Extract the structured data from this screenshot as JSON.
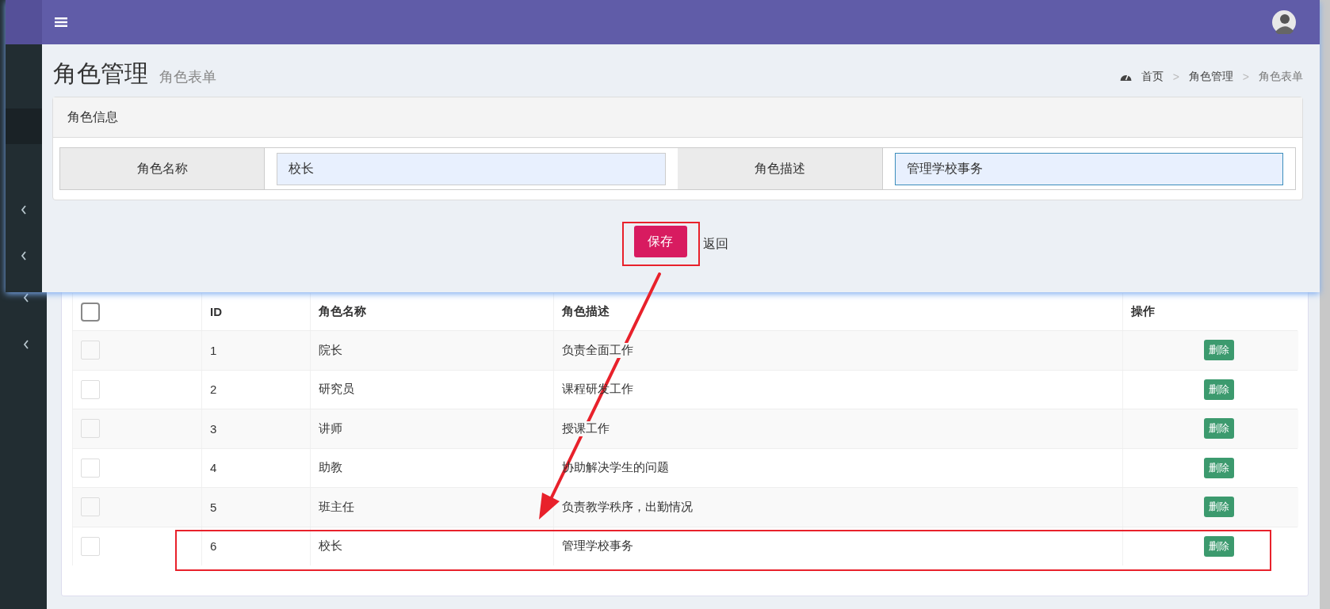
{
  "background_page": {
    "table": {
      "header_checkbox": {
        "checked": false
      },
      "columns": [
        "ID",
        "角色名称",
        "角色描述",
        "操作"
      ],
      "rows": [
        {
          "checked": false,
          "id": "1",
          "name": "院长",
          "description": "负责全面工作",
          "action": "删除"
        },
        {
          "checked": false,
          "id": "2",
          "name": "研究员",
          "description": "课程研发工作",
          "action": "删除"
        },
        {
          "checked": false,
          "id": "3",
          "name": "讲师",
          "description": "授课工作",
          "action": "删除"
        },
        {
          "checked": false,
          "id": "4",
          "name": "助教",
          "description": "协助解决学生的问题",
          "action": "删除"
        },
        {
          "checked": false,
          "id": "5",
          "name": "班主任",
          "description": "负责教学秩序，出勤情况",
          "action": "删除"
        },
        {
          "checked": false,
          "id": "6",
          "name": "校长",
          "description": "管理学校事务",
          "action": "删除",
          "highlighted": true
        }
      ]
    }
  },
  "popup": {
    "page_title": "角色管理",
    "page_subtitle": "角色表单",
    "breadcrumb": [
      {
        "label": "首页",
        "current": false
      },
      {
        "label": "角色管理",
        "current": false
      },
      {
        "label": "角色表单",
        "current": true
      }
    ],
    "breadcrumb_separators": [
      ">",
      ">"
    ],
    "panel": {
      "title": "角色信息",
      "fields": [
        {
          "label": "角色名称",
          "value": "校长",
          "focused": false
        },
        {
          "label": "角色描述",
          "value": "管理学校事务",
          "focused": true
        }
      ]
    },
    "save_button": {
      "label": "保存",
      "highlighted": true
    },
    "back_link": "返回"
  }
}
